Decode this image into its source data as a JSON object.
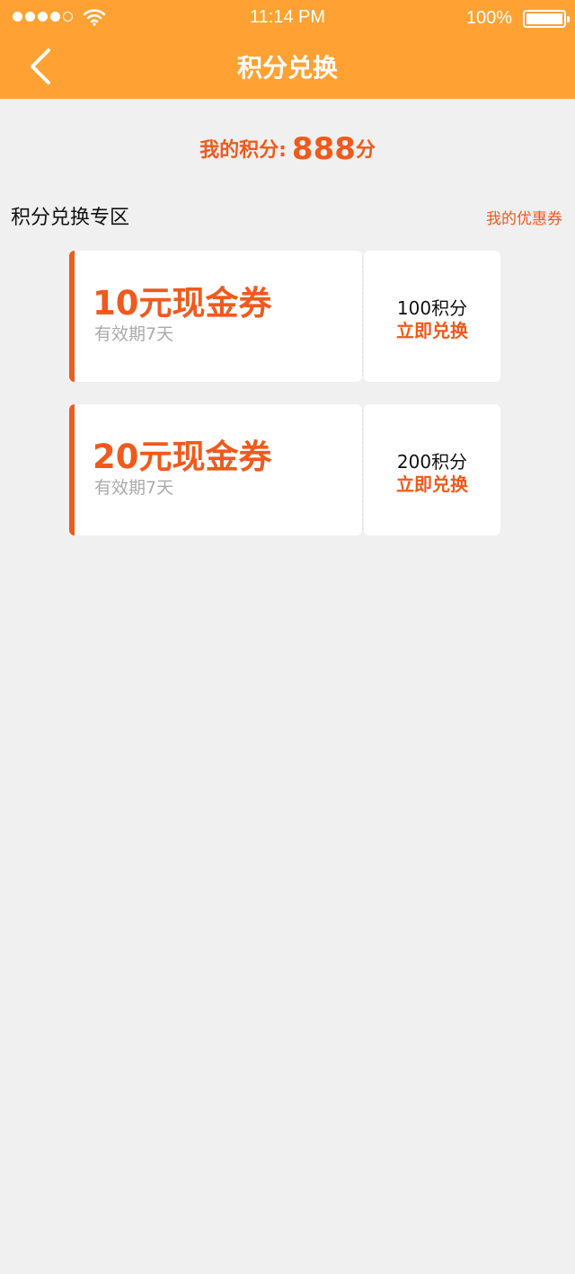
{
  "status_bar": {
    "time": "11:14 PM",
    "battery_percent": "100%",
    "signal_bars_filled": 4,
    "signal_bars_total": 5
  },
  "nav": {
    "title": "积分兑换",
    "back_icon": "chevron-left-icon"
  },
  "points": {
    "label": "我的积分:",
    "value": "888",
    "unit": "分"
  },
  "section": {
    "title": "积分兑换专区",
    "my_coupons_link": "我的优惠券"
  },
  "coupons": [
    {
      "name": "10元现金券",
      "validity": "有效期7天",
      "cost": "100积分",
      "action": "立即兑换"
    },
    {
      "name": "20元现金券",
      "validity": "有效期7天",
      "cost": "200积分",
      "action": "立即兑换"
    }
  ],
  "colors": {
    "header_bg": "#ffa233",
    "accent": "#f05a1c",
    "page_bg": "#f0f0f0"
  }
}
